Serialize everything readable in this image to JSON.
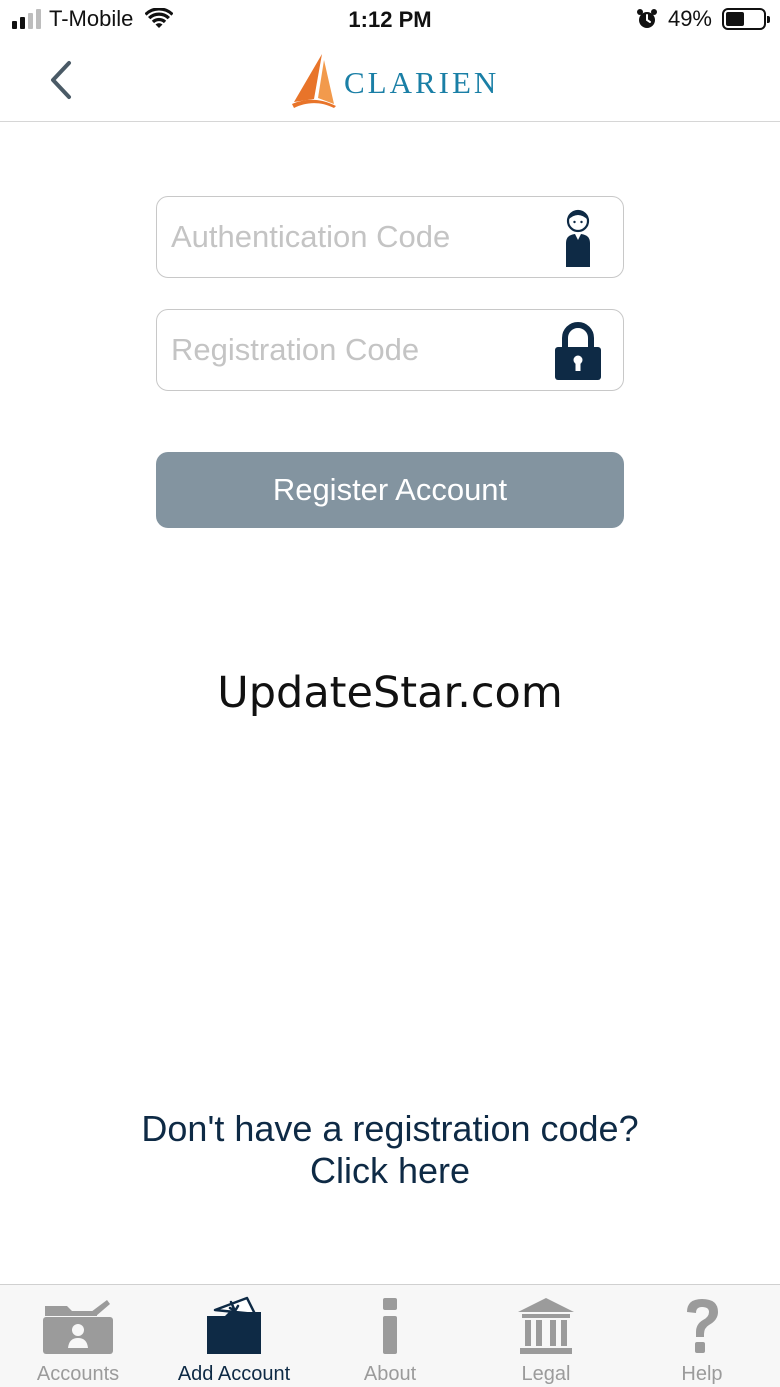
{
  "status_bar": {
    "carrier": "T-Mobile",
    "time": "1:12 PM",
    "battery_percent": "49%",
    "battery_level": 0.49,
    "signal_bars": 2,
    "icons": [
      "signal-icon",
      "wifi-icon",
      "alarm-icon",
      "battery-icon"
    ]
  },
  "nav": {
    "back_icon": "chevron-left-icon",
    "logo_text": "CLARIEN",
    "logo_icon": "sail-logo-icon"
  },
  "form": {
    "auth_field": {
      "placeholder": "Authentication Code",
      "value": "",
      "icon": "user-icon"
    },
    "reg_field": {
      "placeholder": "Registration Code",
      "value": "",
      "icon": "lock-icon"
    },
    "register_button": "Register Account"
  },
  "watermark": "UpdateStar.com",
  "help": {
    "line1": "Don't have a registration code?",
    "line2": "Click here"
  },
  "tabs": [
    {
      "label": "Accounts",
      "icon": "accounts-folder-icon",
      "active": false
    },
    {
      "label": "Add Account",
      "icon": "add-account-folder-icon",
      "active": true
    },
    {
      "label": "About",
      "icon": "info-icon",
      "active": false
    },
    {
      "label": "Legal",
      "icon": "bank-building-icon",
      "active": false
    },
    {
      "label": "Help",
      "icon": "question-mark-icon",
      "active": false
    }
  ],
  "colors": {
    "brand_blue": "#1a7fa6",
    "brand_orange": "#e8742a",
    "button_gray": "#8394a0",
    "dark_navy": "#0e2a45",
    "inactive_gray": "#9b9b9b"
  }
}
